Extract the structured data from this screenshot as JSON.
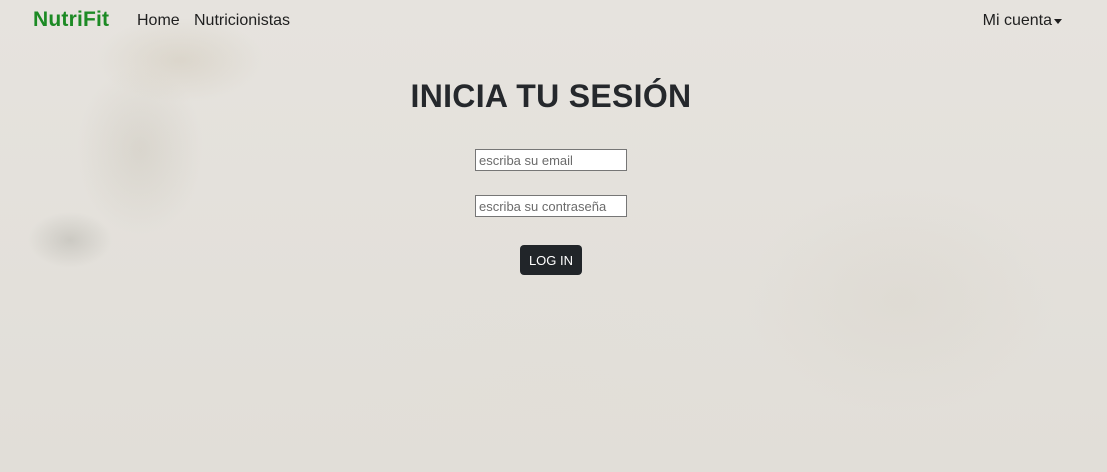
{
  "nav": {
    "brand": "NutriFit",
    "links": [
      {
        "label": "Home"
      },
      {
        "label": "Nutricionistas"
      }
    ],
    "account_label": "Mi cuenta"
  },
  "login": {
    "title": "INICIA TU SESIÓN",
    "email_placeholder": "escriba su email",
    "email_value": "",
    "password_placeholder": "escriba su contraseña",
    "password_value": "",
    "button_label": "LOG IN"
  },
  "colors": {
    "brand": "#1c8a24",
    "button_bg": "#212529",
    "button_text": "#ffffff"
  }
}
